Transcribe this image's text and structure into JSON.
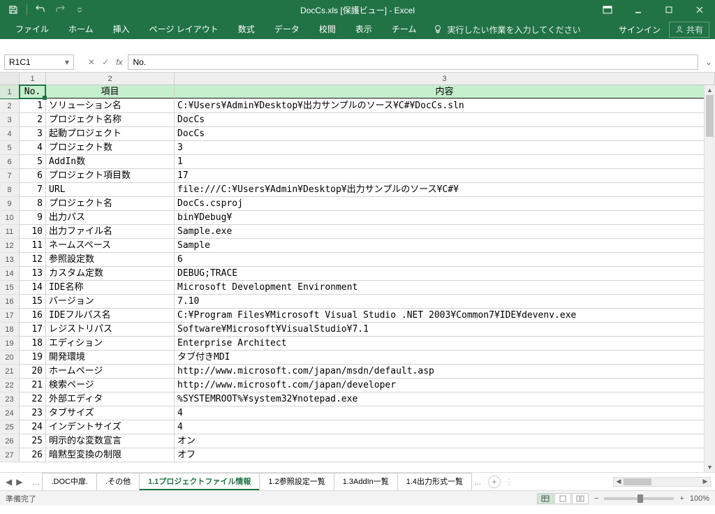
{
  "title": "DocCs.xls  [保護ビュー] - Excel",
  "qat": {
    "save": "save",
    "undo": "undo",
    "redo": "redo"
  },
  "ribbon": {
    "tabs": [
      "ファイル",
      "ホーム",
      "挿入",
      "ページ レイアウト",
      "数式",
      "データ",
      "校閲",
      "表示",
      "チーム"
    ],
    "tell_me": "実行したい作業を入力してください",
    "signin": "サインイン",
    "share": "共有"
  },
  "name_box": "R1C1",
  "formula": "No.",
  "col_headers": [
    "1",
    "2",
    "3"
  ],
  "header_row": {
    "no": "No.",
    "item": "項目",
    "content": "内容"
  },
  "rows": [
    {
      "n": "1",
      "item": "ソリューション名",
      "val": "C:\\Users\\Admin\\Desktop\\出力サンプルのソース\\C#\\DocCs.sln"
    },
    {
      "n": "2",
      "item": "プロジェクト名称",
      "val": "DocCs"
    },
    {
      "n": "3",
      "item": "起動プロジェクト",
      "val": "DocCs"
    },
    {
      "n": "4",
      "item": "プロジェクト数",
      "val": "3"
    },
    {
      "n": "5",
      "item": "AddIn数",
      "val": "1"
    },
    {
      "n": "6",
      "item": "プロジェクト項目数",
      "val": "17"
    },
    {
      "n": "7",
      "item": "URL",
      "val": "file:///C:\\Users\\Admin\\Desktop\\出力サンプルのソース\\C#\\"
    },
    {
      "n": "8",
      "item": "プロジェクト名",
      "val": "DocCs.csproj"
    },
    {
      "n": "9",
      "item": "出力パス",
      "val": "bin\\Debug\\"
    },
    {
      "n": "10",
      "item": "出力ファイル名",
      "val": "Sample.exe"
    },
    {
      "n": "11",
      "item": "ネームスペース",
      "val": "Sample"
    },
    {
      "n": "12",
      "item": "参照設定数",
      "val": "6"
    },
    {
      "n": "13",
      "item": "カスタム定数",
      "val": "DEBUG;TRACE"
    },
    {
      "n": "14",
      "item": "IDE名称",
      "val": "Microsoft Development Environment"
    },
    {
      "n": "15",
      "item": "バージョン",
      "val": "7.10"
    },
    {
      "n": "16",
      "item": "IDEフルパス名",
      "val": "C:\\Program Files\\Microsoft Visual Studio .NET 2003\\Common7\\IDE\\devenv.exe"
    },
    {
      "n": "17",
      "item": "レジストリパス",
      "val": "Software\\Microsoft\\VisualStudio\\7.1"
    },
    {
      "n": "18",
      "item": "エディション",
      "val": "Enterprise Architect"
    },
    {
      "n": "19",
      "item": "開発環境",
      "val": "タブ付きMDI"
    },
    {
      "n": "20",
      "item": "ホームページ",
      "val": "http://www.microsoft.com/japan/msdn/default.asp"
    },
    {
      "n": "21",
      "item": "検索ページ",
      "val": "http://www.microsoft.com/japan/developer"
    },
    {
      "n": "22",
      "item": "外部エディタ",
      "val": "%SYSTEMROOT%\\system32\\notepad.exe"
    },
    {
      "n": "23",
      "item": "タブサイズ",
      "val": "4"
    },
    {
      "n": "24",
      "item": "インデントサイズ",
      "val": "4"
    },
    {
      "n": "25",
      "item": "明示的な変数宣言",
      "val": "オン"
    },
    {
      "n": "26",
      "item": "暗黙型変換の制限",
      "val": "オフ"
    }
  ],
  "sheets": {
    "more_left": "...",
    "tabs": [
      {
        "label": ".DOC中扉.",
        "active": false
      },
      {
        "label": ".その他",
        "active": false
      },
      {
        "label": "1.1プロジェクトファイル情報",
        "active": true
      },
      {
        "label": "1.2参照設定一覧",
        "active": false
      },
      {
        "label": "1.3AddIn一覧",
        "active": false
      },
      {
        "label": "1.4出力形式一覧",
        "active": false
      }
    ],
    "more_right": "..."
  },
  "status": {
    "ready": "準備完了",
    "zoom": "100%"
  }
}
